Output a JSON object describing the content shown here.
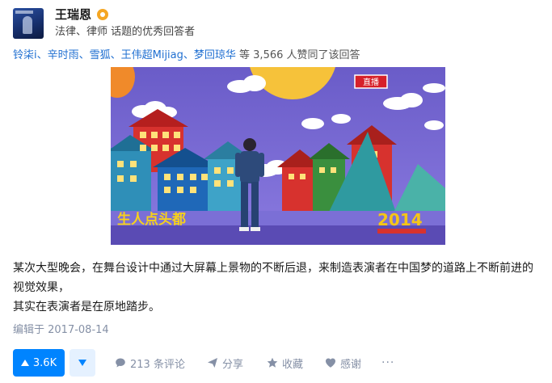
{
  "author": {
    "name": "王瑞恩",
    "badge_icon": "verified-badge-icon",
    "description": "法律、律师 话题的优秀回答者"
  },
  "upvoters": {
    "names": "铃柒i、辛时雨、雪狐、王伟超Mijiag、梦回琼华",
    "suffix": "等 3,566 人赞同了该回答"
  },
  "image": {
    "caption_left": "生人点头都",
    "caption_right": "2014",
    "sign_text": "直播"
  },
  "content": {
    "paragraph1": "某次大型晚会，在舞台设计中通过大屏幕上景物的不断后退，来制造表演者在中国梦的道路上不断前进的视觉效果，",
    "paragraph2": "其实在表演者是在原地踏步。"
  },
  "edited": "编辑于 2017-08-14",
  "actions": {
    "upvote_count": "3.6K",
    "comments": "213 条评论",
    "share": "分享",
    "favorite": "收藏",
    "thanks": "感谢",
    "more": "···"
  },
  "colors": {
    "accent": "#0084ff",
    "link": "#1f6fd1",
    "muted": "#8590a6"
  }
}
